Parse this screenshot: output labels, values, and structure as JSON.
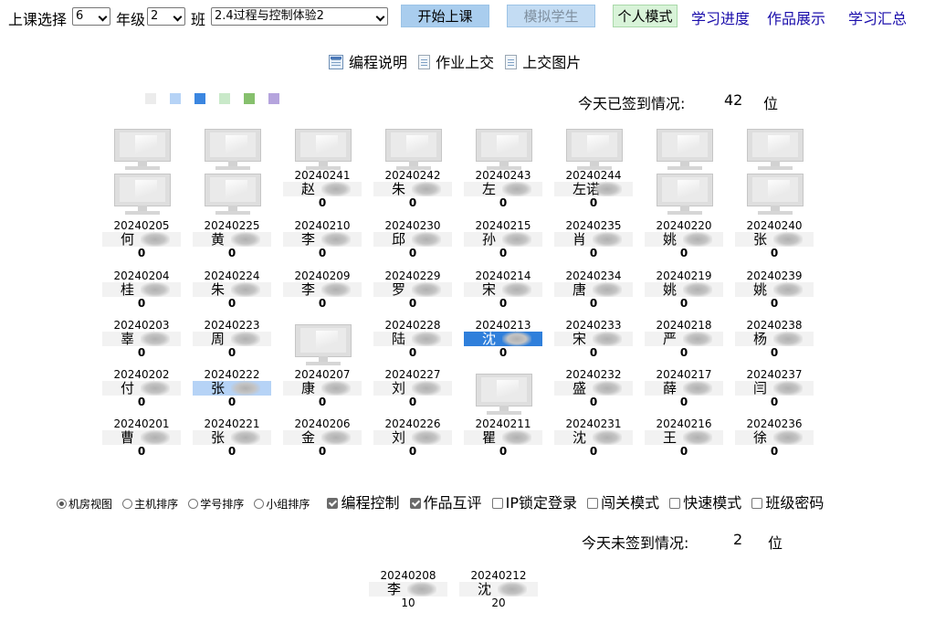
{
  "toolbar": {
    "lesson_label": "上课选择",
    "lesson_value": "6",
    "grade_label": "年级",
    "grade_value": "2",
    "class_label": "班",
    "course_value": "2.4过程与控制体验2",
    "start_button": "开始上课",
    "simulate_button": "模拟学生",
    "personal_mode_button": "个人模式",
    "progress_link": "学习进度",
    "works_link": "作品展示",
    "summary_link": "学习汇总"
  },
  "links": {
    "instructions": "编程说明",
    "homework": "作业上交",
    "upload_image": "上交图片"
  },
  "legend_colors": [
    "#ececec",
    "#b6d3f6",
    "#3b86e0",
    "#c9e9c9",
    "#86c06d",
    "#b5a4dd"
  ],
  "checkin": {
    "label": "今天已签到情况:",
    "count": "42",
    "unit": "位"
  },
  "not_checked_in": {
    "label": "今天未签到情况:",
    "count": "2",
    "unit": "位"
  },
  "grid": {
    "top_monitors": 8,
    "students": [
      {
        "id": "20240241",
        "name": "赵",
        "count": "0"
      },
      {
        "id": "20240242",
        "name": "朱",
        "count": "0"
      },
      {
        "id": "20240243",
        "name": "左",
        "count": "0"
      },
      {
        "id": "20240244",
        "name": "左诺",
        "count": "0"
      },
      {
        "id": "20240205",
        "name": "何",
        "count": "0"
      },
      {
        "id": "20240225",
        "name": "黄",
        "count": "0"
      },
      {
        "id": "20240210",
        "name": "李",
        "count": "0"
      },
      {
        "id": "20240230",
        "name": "邱",
        "count": "0"
      },
      {
        "id": "20240215",
        "name": "孙",
        "count": "0"
      },
      {
        "id": "20240235",
        "name": "肖",
        "count": "0"
      },
      {
        "id": "20240220",
        "name": "姚",
        "count": "0"
      },
      {
        "id": "20240240",
        "name": "张",
        "count": "0"
      },
      {
        "id": "20240204",
        "name": "桂",
        "count": "0"
      },
      {
        "id": "20240224",
        "name": "朱",
        "count": "0"
      },
      {
        "id": "20240209",
        "name": "李",
        "count": "0"
      },
      {
        "id": "20240229",
        "name": "罗",
        "count": "0"
      },
      {
        "id": "20240214",
        "name": "宋",
        "count": "0"
      },
      {
        "id": "20240234",
        "name": "唐",
        "count": "0"
      },
      {
        "id": "20240219",
        "name": "姚",
        "count": "0"
      },
      {
        "id": "20240239",
        "name": "姚",
        "count": "0"
      },
      {
        "id": "20240203",
        "name": "辜",
        "count": "0"
      },
      {
        "id": "20240223",
        "name": "周",
        "count": "0"
      },
      {
        "id": "20240228",
        "name": "陆",
        "count": "0"
      },
      {
        "id": "20240213",
        "name": "沈",
        "count": "0"
      },
      {
        "id": "20240233",
        "name": "宋",
        "count": "0"
      },
      {
        "id": "20240218",
        "name": "严",
        "count": "0"
      },
      {
        "id": "20240238",
        "name": "杨",
        "count": "0"
      },
      {
        "id": "20240202",
        "name": "付",
        "count": "0"
      },
      {
        "id": "20240222",
        "name": "张",
        "count": "0"
      },
      {
        "id": "20240207",
        "name": "康",
        "count": "0"
      },
      {
        "id": "20240227",
        "name": "刘",
        "count": "0"
      },
      {
        "id": "20240232",
        "name": "盛",
        "count": "0"
      },
      {
        "id": "20240217",
        "name": "薛",
        "count": "0"
      },
      {
        "id": "20240237",
        "name": "闫",
        "count": "0"
      },
      {
        "id": "20240201",
        "name": "曹",
        "count": "0"
      },
      {
        "id": "20240221",
        "name": "张",
        "count": "0"
      },
      {
        "id": "20240206",
        "name": "金",
        "count": "0"
      },
      {
        "id": "20240226",
        "name": "刘",
        "count": "0"
      },
      {
        "id": "20240211",
        "name": "瞿",
        "count": "0"
      },
      {
        "id": "20240231",
        "name": "沈",
        "count": "0"
      },
      {
        "id": "20240216",
        "name": "王",
        "count": "0"
      },
      {
        "id": "20240236",
        "name": "徐",
        "count": "0"
      }
    ]
  },
  "absent": [
    {
      "id": "20240208",
      "name": "李",
      "count": "10"
    },
    {
      "id": "20240212",
      "name": "沈",
      "count": "20"
    }
  ],
  "view_options": {
    "room_view": "机房视图",
    "host_sort": "主机排序",
    "id_sort": "学号排序",
    "group_sort": "小组排序",
    "programming_control": "编程控制",
    "peer_review": "作品互评",
    "ip_lock": "IP锁定登录",
    "challenge_mode": "闯关模式",
    "quick_mode": "快速模式",
    "class_password": "班级密码"
  }
}
